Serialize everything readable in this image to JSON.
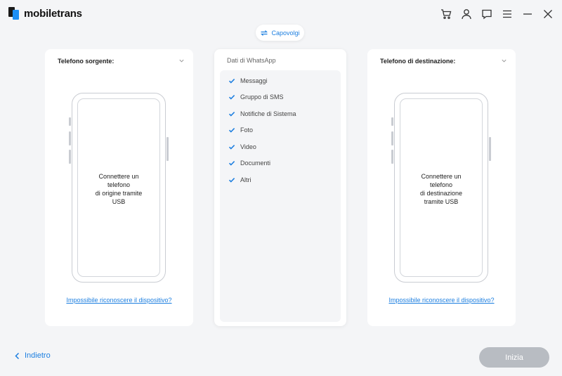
{
  "app": {
    "logo_bold": "mobile",
    "logo_rest": "trans",
    "accent_color": "#1d7fe0"
  },
  "titlebar": {
    "icons": [
      "cart-icon",
      "user-icon",
      "feedback-icon",
      "menu-icon",
      "minimize-icon",
      "close-icon"
    ]
  },
  "swap": {
    "label": "Capovolgi",
    "icon": "swap-icon"
  },
  "source": {
    "title": "Telefono sorgente:",
    "message": "Connettere un\ntelefono\ndi origine tramite\nUSB",
    "help_link": "Impossibile riconoscere il dispositivo?"
  },
  "destination": {
    "title": "Telefono di destinazione:",
    "message": "Connettere un\ntelefono\ndi destinazione\ntramite USB",
    "help_link": "Impossibile riconoscere il dispositivo?"
  },
  "data_panel": {
    "title": "Dati di WhatsApp",
    "items": [
      {
        "label": "Messaggi",
        "checked": true
      },
      {
        "label": "Gruppo di SMS",
        "checked": true
      },
      {
        "label": "Notifiche di Sistema",
        "checked": true
      },
      {
        "label": "Foto",
        "checked": true
      },
      {
        "label": "Video",
        "checked": true
      },
      {
        "label": "Documenti",
        "checked": true
      },
      {
        "label": "Altri",
        "checked": true
      }
    ]
  },
  "footer": {
    "back_label": "Indietro",
    "start_label": "Inizia"
  }
}
